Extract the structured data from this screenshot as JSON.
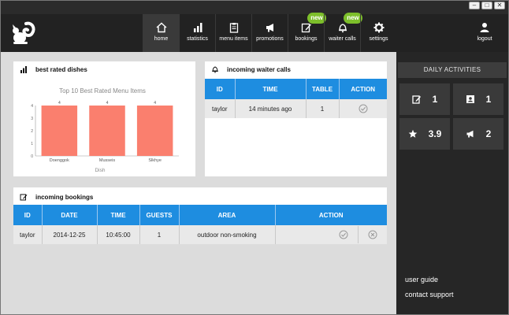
{
  "window": {
    "minimize": "–",
    "maximize": "□",
    "close": "✕"
  },
  "nav": {
    "items": [
      {
        "label": "home",
        "icon": "home-icon"
      },
      {
        "label": "statistics",
        "icon": "bar-chart-icon"
      },
      {
        "label": "menu items",
        "icon": "clipboard-icon"
      },
      {
        "label": "promotions",
        "icon": "megaphone-icon"
      },
      {
        "label": "bookings",
        "icon": "edit-icon",
        "badge": "new"
      },
      {
        "label": "waiter calls",
        "icon": "bell-icon",
        "badge": "new"
      },
      {
        "label": "settings",
        "icon": "gear-icon"
      }
    ],
    "logout": "logout"
  },
  "best_rated": {
    "title": "best rated dishes",
    "chart_data": {
      "type": "bar",
      "title": "Top 10 Best Rated Menu Items",
      "categories": [
        "Doenggok",
        "Musseis",
        "Slkhye"
      ],
      "values": [
        4,
        4,
        4
      ],
      "data_labels": [
        "4",
        "4",
        "4"
      ],
      "xlabel": "Dish",
      "ylabel": "",
      "ylim": [
        0,
        4
      ],
      "yticks": [
        "0",
        "1",
        "2",
        "3",
        "4"
      ],
      "bar_color": "#fa7f6e"
    }
  },
  "waiter_calls": {
    "title": "incoming waiter calls",
    "columns": [
      "ID",
      "TIME",
      "TABLE",
      "ACTION"
    ],
    "rows": [
      {
        "id": "taylor",
        "time": "14 minutes ago",
        "table": "1"
      }
    ]
  },
  "bookings": {
    "title": "incoming bookings",
    "columns": [
      "ID",
      "DATE",
      "TIME",
      "GUESTS",
      "AREA",
      "ACTION"
    ],
    "rows": [
      {
        "id": "taylor",
        "date": "2014-12-25",
        "time": "10:45:00",
        "guests": "1",
        "area": "outdoor non-smoking"
      }
    ]
  },
  "daily": {
    "title": "DAILY ACTIVITIES",
    "tiles": [
      {
        "icon": "edit-icon",
        "value": "1"
      },
      {
        "icon": "contact-card-icon",
        "value": "1"
      },
      {
        "icon": "star-icon",
        "value": "3.9"
      },
      {
        "icon": "megaphone-icon",
        "value": "2"
      }
    ],
    "links": [
      "user guide",
      "contact support"
    ]
  },
  "colors": {
    "accent": "#1e8de0",
    "badge": "#7dbf2b",
    "bar": "#fa7f6e",
    "sidebar": "#262626"
  }
}
